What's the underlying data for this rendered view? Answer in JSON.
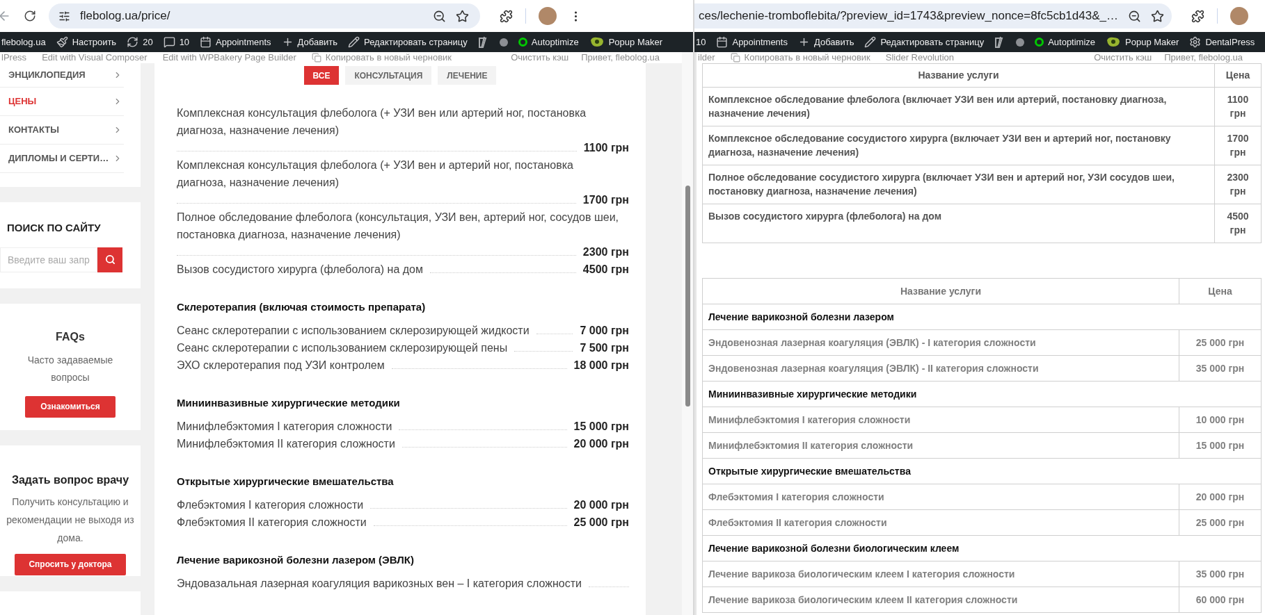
{
  "left_window": {
    "url": "flebolog.ua/price/",
    "admin_bar": [
      {
        "kind": "site",
        "label": "flebolog.ua"
      },
      {
        "kind": "brush",
        "label": "Настроить"
      },
      {
        "kind": "sync",
        "label": "20"
      },
      {
        "kind": "comments",
        "label": "10"
      },
      {
        "kind": "calendar",
        "label": "Appointments"
      },
      {
        "kind": "add",
        "label": "Добавить"
      },
      {
        "kind": "edit",
        "label": "Редактировать страницу"
      },
      {
        "kind": "seo"
      },
      {
        "kind": "dot"
      },
      {
        "kind": "status",
        "label": "Autoptimize"
      },
      {
        "kind": "popup",
        "label": "Popup Maker"
      }
    ],
    "ghost_toolbar": {
      "left": [
        {
          "kind": "text",
          "label": "lPress"
        },
        {
          "kind": "text",
          "label": "Edit with Visual Composer"
        },
        {
          "kind": "text",
          "label": "Edit with WPBakery Page Builder"
        },
        {
          "kind": "copy",
          "label": "Копировать в новый черновик"
        }
      ],
      "right": [
        {
          "kind": "text",
          "label": "Очистить кэш"
        },
        {
          "kind": "text",
          "label": "Привет, flebolog.ua"
        }
      ]
    },
    "sidebar": {
      "menu": [
        {
          "label": "ЭНЦИКЛОПЕДИЯ",
          "selected": false
        },
        {
          "label": "ЦЕНЫ",
          "selected": true
        },
        {
          "label": "КОНТАКТЫ",
          "selected": false
        },
        {
          "label": "ДИПЛОМЫ И СЕРТИ…",
          "selected": false
        }
      ],
      "search": {
        "title": "ПОИСК ПО САЙТУ",
        "placeholder": "Введите ваш запр"
      },
      "faq": {
        "title": "FAQs",
        "text": "Часто задаваемые вопросы",
        "button": "Ознакомиться"
      },
      "ask": {
        "title": "Задать вопрос врачу",
        "text": "Получить консультацию и рекомендации не выходя из дома.",
        "button": "Спросить у доктора"
      }
    },
    "filter_tabs": [
      {
        "label": "ВСЕ",
        "selected": true
      },
      {
        "label": "КОНСУЛЬТАЦИЯ",
        "selected": false
      },
      {
        "label": "ЛЕЧЕНИЕ",
        "selected": false
      }
    ],
    "price_sections": [
      {
        "items": [
          {
            "name": "Комплексная консультация флеболога (+ УЗИ вен или артерий ног, постановка диагноза, назначение лечения)",
            "price": "1100 грн"
          },
          {
            "name": "Комплексная консультация флеболога (+ УЗИ вен и артерий ног, постановка диагноза, назначение лечения)",
            "price": "1700 грн"
          },
          {
            "name": "Полное обследование флеболога (консультация, УЗИ вен, артерий ног, сосудов шеи, постановка диагноза, назначение лечения)",
            "price": "2300 грн"
          },
          {
            "name": "Вызов сосудистого хирурга (флеболога) на дом",
            "price": "4500 грн"
          }
        ]
      },
      {
        "heading": "Склеротерапия (включая стоимость препарата)",
        "items": [
          {
            "name": "Сеанс склеротерапии с использованием склерозирующей жидкости",
            "price": "7 000 грн"
          },
          {
            "name": "Сеанс склеротерапии с использованием склерозирующей пены",
            "price": "7 500 грн"
          },
          {
            "name": "ЭХО склеротерапия под УЗИ контролем",
            "price": "18 000 грн"
          }
        ]
      },
      {
        "heading": "Миниинвазивные хирургические методики",
        "items": [
          {
            "name": "Минифлебэктомия I категория сложности",
            "price": "15 000 грн"
          },
          {
            "name": "Минифлебэктомия II категория сложности",
            "price": "20 000 грн"
          }
        ]
      },
      {
        "heading": "Открытые хирургические вмешательства",
        "items": [
          {
            "name": "Флебэктомия I категория сложности",
            "price": "20 000 грн"
          },
          {
            "name": "Флебэктомия II категория сложности",
            "price": "25 000 грн"
          }
        ]
      },
      {
        "heading": "Лечение варикозной болезни лазером (ЭВЛК)",
        "items": [
          {
            "name": "Эндовазальная лазерная коагуляция варикозных вен – I категория сложности"
          }
        ]
      }
    ]
  },
  "right_window": {
    "url": "ces/lechenie-tromboflebita/?preview_id=1743&preview_nonce=8fc5cb1d43&_…",
    "admin_bar": [
      {
        "kind": "comments_count",
        "label": "10"
      },
      {
        "kind": "calendar",
        "label": "Appointments"
      },
      {
        "kind": "add",
        "label": "Добавить"
      },
      {
        "kind": "edit",
        "label": "Редактировать страницу"
      },
      {
        "kind": "seo"
      },
      {
        "kind": "dot"
      },
      {
        "kind": "status",
        "label": "Autoptimize"
      },
      {
        "kind": "popup",
        "label": "Popup Maker"
      },
      {
        "kind": "gear",
        "label": "DentalPress"
      }
    ],
    "ghost_toolbar": {
      "left": [
        {
          "kind": "text",
          "label": "ilder"
        },
        {
          "kind": "copy",
          "label": "Копировать в новый черновик"
        },
        {
          "kind": "text",
          "label": "Slider Revolution"
        }
      ],
      "right": [
        {
          "kind": "text",
          "label": "Очистить кэш"
        },
        {
          "kind": "text",
          "label": "Привет, flebolog.ua"
        }
      ]
    },
    "tables": [
      {
        "columns": [
          "Название услуги",
          "Цена"
        ],
        "rows": [
          {
            "kind": "item",
            "name": "Комплексное обследование флеболога (включает УЗИ вен или артерий, постановку диагноза, назначение лечения)",
            "price": "1100 грн"
          },
          {
            "kind": "item",
            "name": "Комплексное обследование сосудистого хирурга (включает УЗИ вен и артерий ног, постановку диагноза, назначение лечения)",
            "price": "1700 грн"
          },
          {
            "kind": "item",
            "name": "Полное обследование сосудистого хирурга (включает УЗИ вен и артерий ног, УЗИ сосудов шеи, постановку диагноза, назначение лечения)",
            "price": "2300 грн"
          },
          {
            "kind": "item",
            "name": "Вызов сосудистого хирурга (флеболога) на дом",
            "price": "4500 грн"
          }
        ]
      },
      {
        "columns": [
          "Название услуги",
          "Цена"
        ],
        "rows": [
          {
            "kind": "group",
            "name": "Лечение варикозной болезни лазером"
          },
          {
            "kind": "item",
            "name": "Эндовенозная лазерная коагуляция (ЭВЛК) - I категория сложности",
            "price": "25 000 грн"
          },
          {
            "kind": "item",
            "name": "Эндовенозная лазерная коагуляция (ЭВЛК) - II категория сложности",
            "price": "35 000 грн"
          },
          {
            "kind": "group",
            "name": "Миниинвазивные хирургические методики"
          },
          {
            "kind": "item",
            "name": "Минифлебэктомия I категория сложности",
            "price": "10 000 грн"
          },
          {
            "kind": "item",
            "name": "Минифлебэктомия II категория сложности",
            "price": "15 000 грн"
          },
          {
            "kind": "group",
            "name": "Открытые хирургические вмешательства"
          },
          {
            "kind": "item",
            "name": "Флебэктомия I категория сложности",
            "price": "20 000 грн"
          },
          {
            "kind": "item",
            "name": "Флебэктомия II категория сложности",
            "price": "25 000 грн"
          },
          {
            "kind": "group",
            "name": "Лечение варикозной болезни биологическим клеем"
          },
          {
            "kind": "item",
            "name": "Лечение варикоза биологическим клеем I категория сложности",
            "price": "35 000 грн"
          },
          {
            "kind": "item",
            "name": "Лечение варикоза биологическим клеем II категория сложности",
            "price": "60 000 грн"
          }
        ]
      }
    ]
  }
}
